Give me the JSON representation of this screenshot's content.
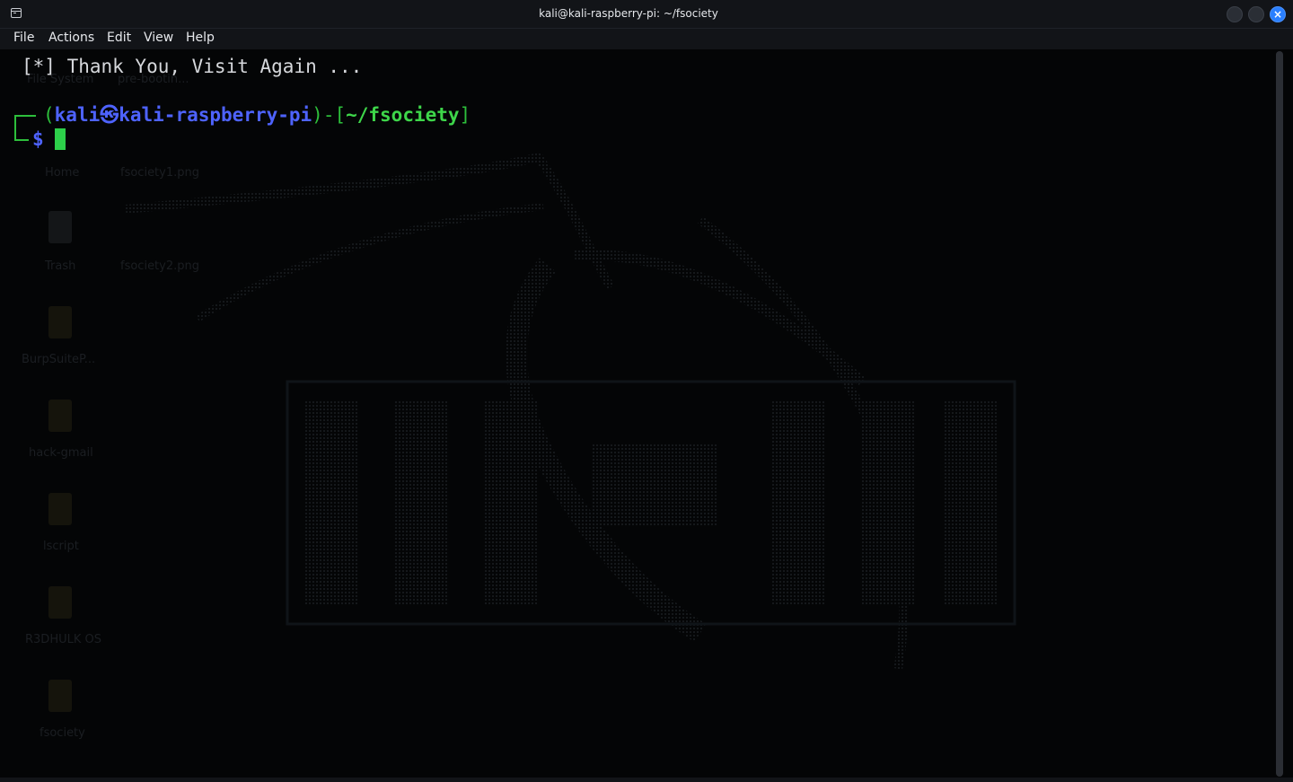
{
  "window": {
    "title": "kali@kali-raspberry-pi: ~/fsociety",
    "close_glyph": "×"
  },
  "menu": [
    {
      "label": "File"
    },
    {
      "label": "Actions"
    },
    {
      "label": "Edit"
    },
    {
      "label": "View"
    },
    {
      "label": "Help"
    }
  ],
  "terminal": {
    "output_line": "[*] Thank You, Visit Again ...",
    "prompt": {
      "open_paren": "(",
      "user": "kali",
      "separator": "㉿",
      "host": "kali-raspberry-pi",
      "mid": ")-[",
      "cwd": "~/fsociety",
      "close": "]",
      "symbol": "$"
    }
  },
  "desktop_icons": [
    {
      "label": "File System"
    },
    {
      "label": "pre-bootin..."
    },
    {
      "label": "Home"
    },
    {
      "label": "fsociety1.png"
    },
    {
      "label": "Trash"
    },
    {
      "label": "fsociety2.png"
    },
    {
      "label": "BurpSuiteP..."
    },
    {
      "label": "hack-gmail"
    },
    {
      "label": "lscript"
    },
    {
      "label": "R3DHULK OS"
    },
    {
      "label": "fsociety"
    }
  ],
  "colors": {
    "prompt_green": "#2dbf3b",
    "prompt_blue": "#4e63ff",
    "cursor": "#2dd04a",
    "accent_close": "#2a7fff"
  }
}
